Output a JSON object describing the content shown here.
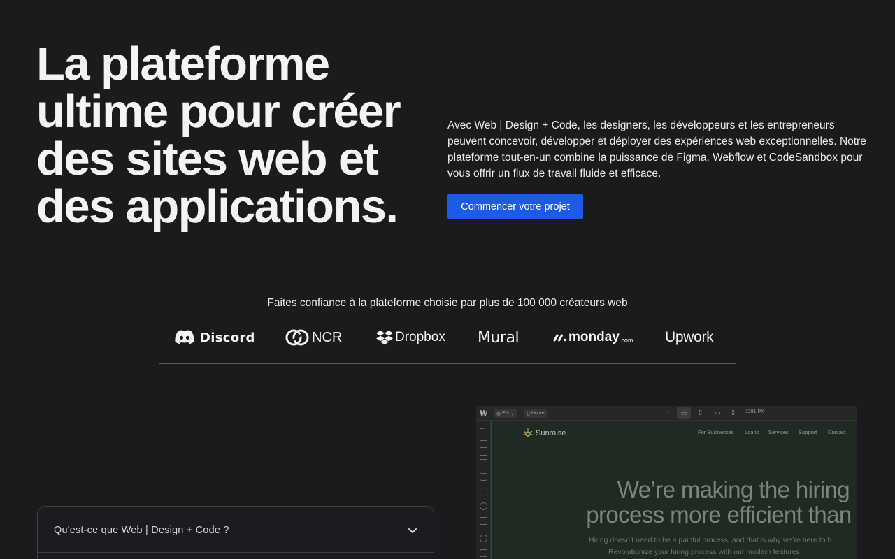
{
  "hero": {
    "title": "La plateforme ultime pour créer des sites web et des applications.",
    "description": "Avec Web | Design + Code, les designers, les développeurs et les entrepreneurs peuvent concevoir, développer et déployer des expériences web exceptionnelles. Notre plateforme tout-en-un combine la puissance de Figma, Webflow et CodeSandbox pour vous offrir un flux de travail fluide et efficace.",
    "cta_label": "Commencer votre projet"
  },
  "trust": {
    "text": "Faites confiance à la plateforme choisie par plus de 100 000 créateurs web",
    "logos": [
      {
        "name": "Discord",
        "icon": "discord-icon"
      },
      {
        "name": "NCR",
        "icon": "ncr-icon"
      },
      {
        "name": "Dropbox",
        "icon": "dropbox-icon"
      },
      {
        "name": "Mural",
        "icon": "mural-icon"
      },
      {
        "name": "monday",
        "suffix": ".com",
        "icon": "monday-icon"
      },
      {
        "name": "Upwork",
        "icon": "upwork-icon"
      }
    ]
  },
  "faq": {
    "items": [
      {
        "question": "Qu'est-ce que Web | Design + Code ?",
        "icon": "chevron-down-icon"
      }
    ]
  },
  "editor_preview": {
    "toolbar": {
      "locale": "EN",
      "page": "Home",
      "width_readout": "1291 PX"
    },
    "site": {
      "brand": "Sunraise",
      "nav": [
        "For Businesses",
        "Loans",
        "Services",
        "Support",
        "Contact"
      ],
      "headline_line1": "We’re making the hiring",
      "headline_line2": "process more efficient than e",
      "sub_line1": "Hiring doesn’t need to be a painful process, and that is why we’re here to h",
      "sub_line2": "Revolutionize your hiring process with our modern features."
    }
  },
  "colors": {
    "background": "#1b1b1e",
    "accent": "#1d5ae8",
    "text": "#f4f4f6"
  }
}
